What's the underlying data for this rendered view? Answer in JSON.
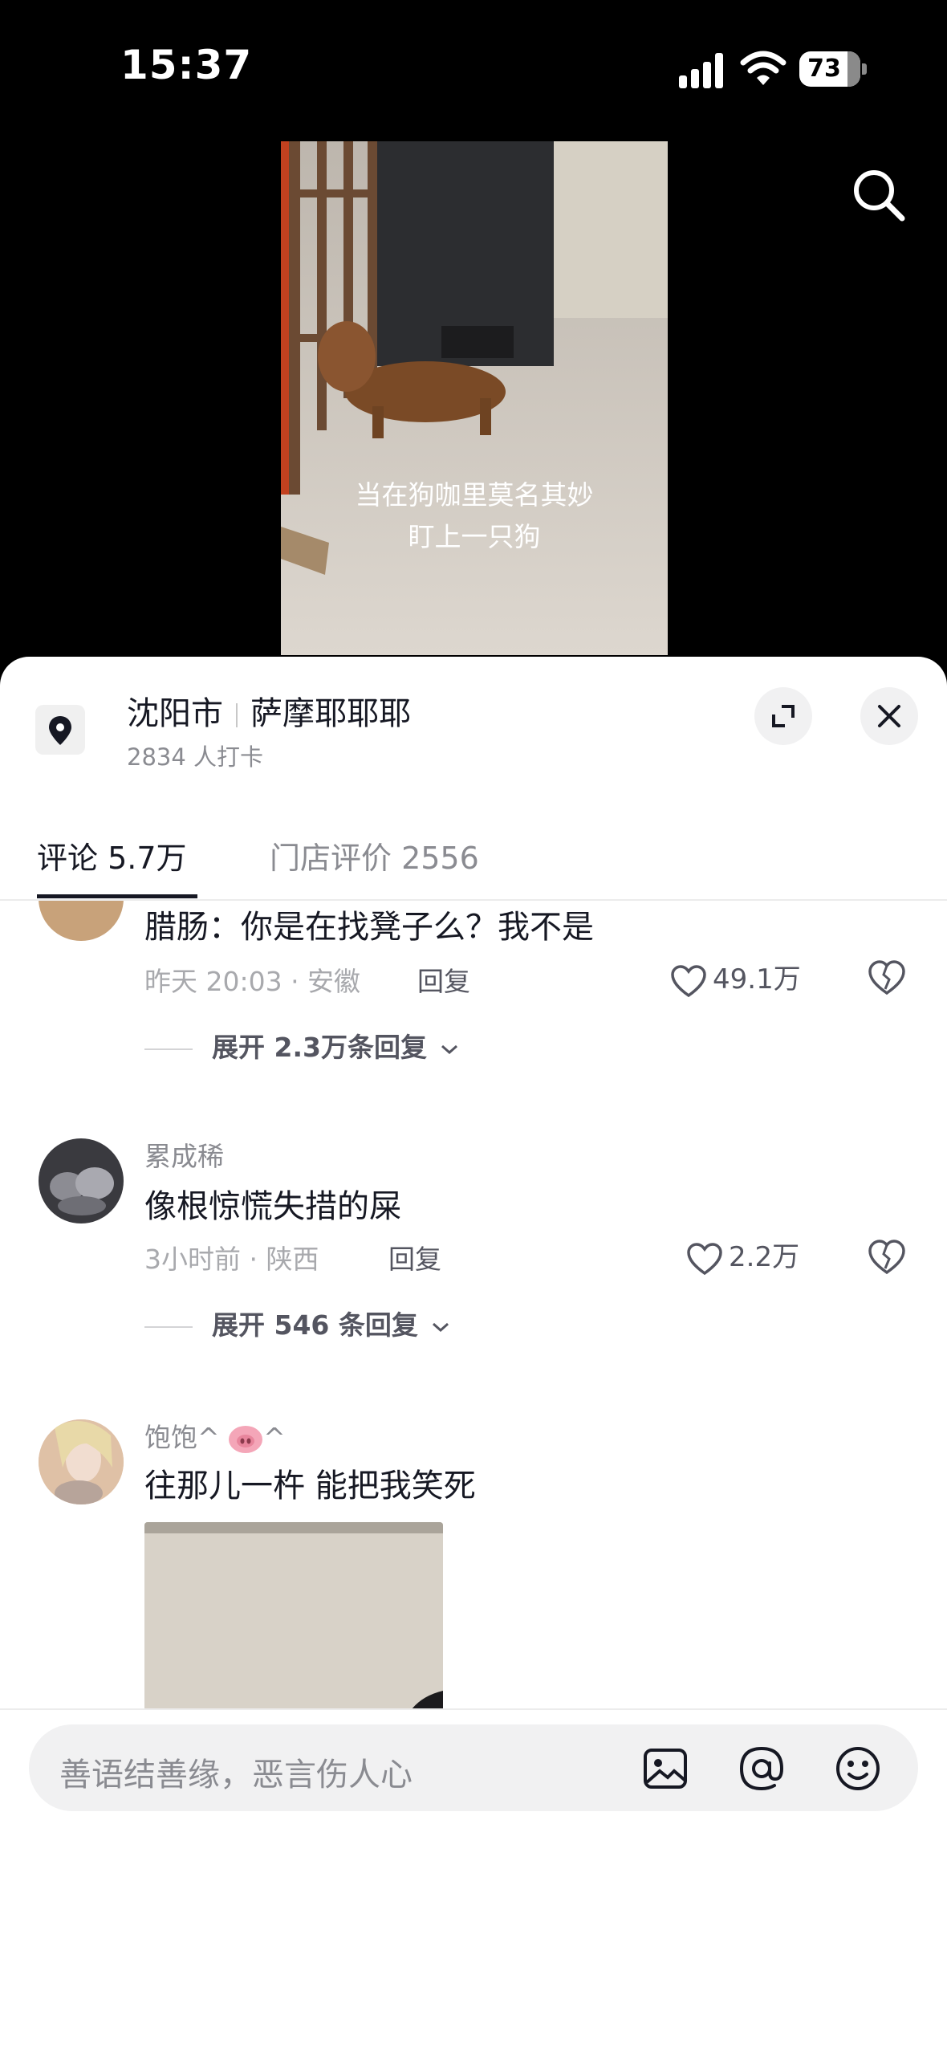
{
  "status_bar": {
    "time": "15:37",
    "battery": "73"
  },
  "video": {
    "caption_line1": "当在狗咖里莫名其妙",
    "caption_line2": "盯上一只狗"
  },
  "location": {
    "city": "沈阳市",
    "store": "萨摩耶耶耶",
    "checkins": "2834 人打卡"
  },
  "tabs": [
    {
      "label": "评论 5.7万",
      "active": true
    },
    {
      "label": "门店评价 2556",
      "active": false
    }
  ],
  "comments": [
    {
      "text": "腊肠：你是在找凳子么？我不是",
      "meta": "昨天 20:03 · 安徽",
      "reply": "回复",
      "likes": "49.1万",
      "expand": "展开 2.3万条回复"
    },
    {
      "name": "累成稀",
      "text": "像根惊慌失措的屎",
      "meta": "3小时前 · 陕西",
      "reply": "回复",
      "likes": "2.2万",
      "expand": "展开 546 条回复"
    },
    {
      "name": "饱饱^",
      "name_suffix": "^",
      "text": "往那儿一杵 能把我笑死"
    }
  ],
  "input": {
    "placeholder": "善语结善缘，恶言伤人心"
  },
  "icons": [
    "signal-icon",
    "wifi-icon",
    "battery-icon",
    "search-icon",
    "location-pin-icon",
    "expand-icon",
    "close-icon",
    "heart-icon",
    "broken-heart-icon",
    "chevron-down-icon",
    "image-icon",
    "at-icon",
    "emoji-icon"
  ]
}
